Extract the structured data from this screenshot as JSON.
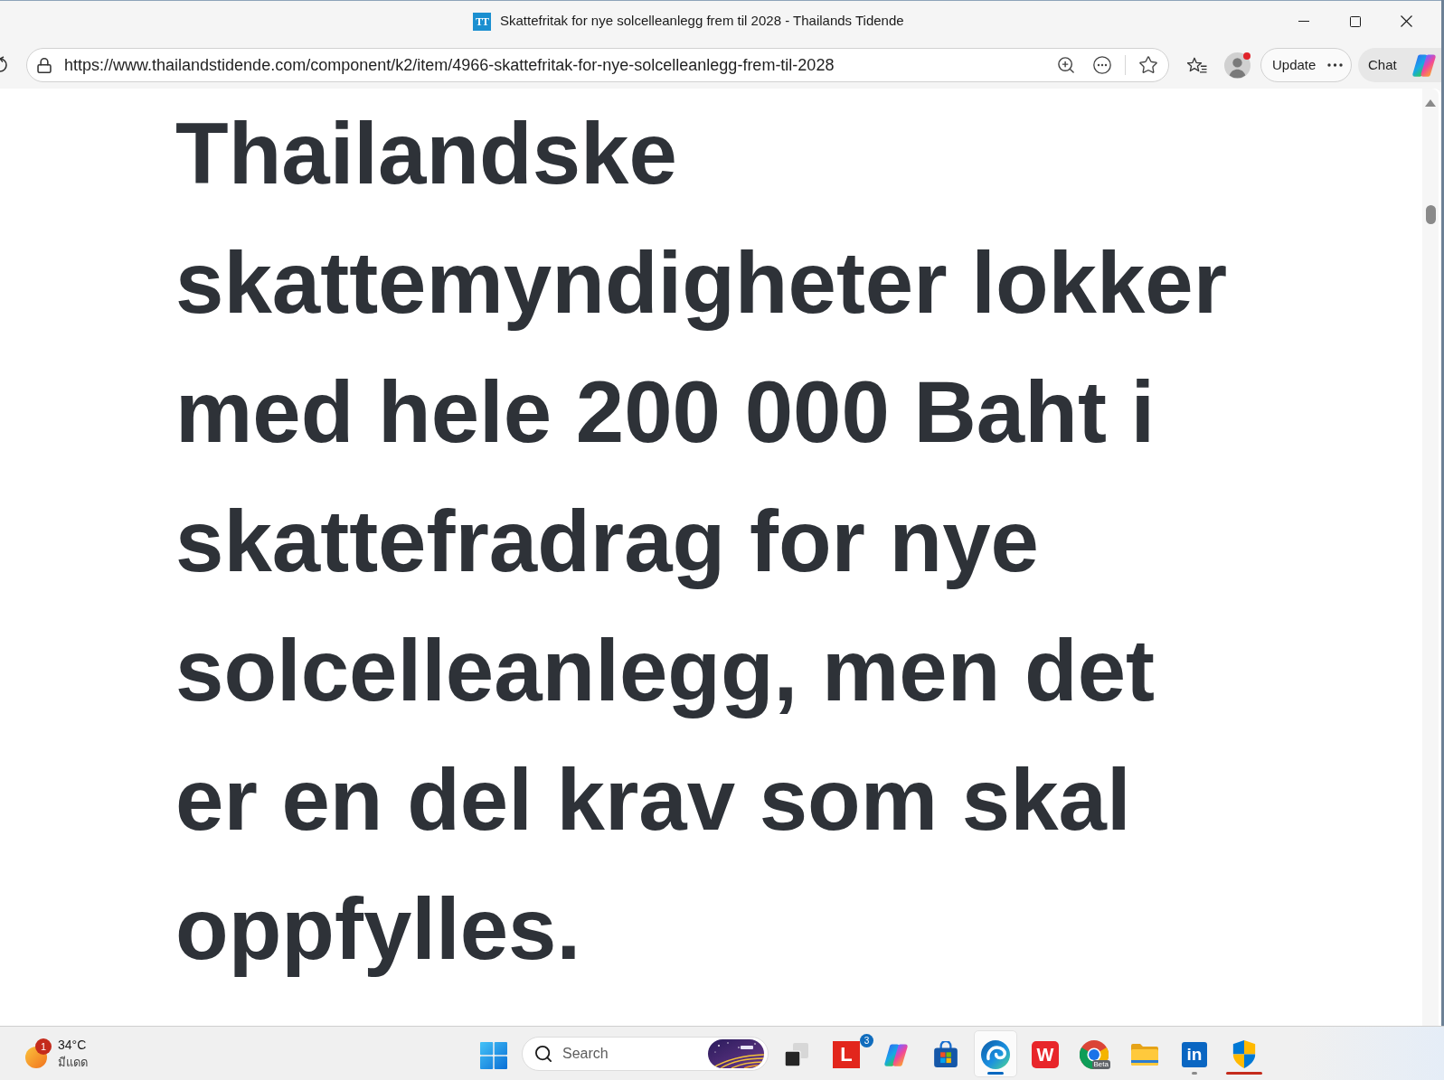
{
  "window": {
    "favicon": "TT",
    "title": "Skattefritak for nye solcelleanlegg frem til 2028 - Thailands Tidende"
  },
  "toolbar": {
    "url": "https://www.thailandstidende.com/component/k2/item/4966-skattefritak-for-nye-solcelleanlegg-frem-til-2028",
    "profile": {
      "notification": true
    },
    "update_button": "Update",
    "chat_button": "Chat"
  },
  "article": {
    "heading": "Thailandske skattemyndigheter lokker med hele 200 000 Baht i skattefradrag for nye solcelleanlegg, men det er en del krav som skal oppfylles."
  },
  "taskbar": {
    "weather": {
      "badge": "1",
      "temperature": "34°C",
      "condition": "มีแดด"
    },
    "search": {
      "placeholder": "Search"
    },
    "apps": [
      {
        "kind": "taskview",
        "selected": false,
        "running": false,
        "alert": false
      },
      {
        "kind": "letter",
        "text": "L",
        "badge": "3",
        "selected": false,
        "running": false,
        "alert": false
      },
      {
        "kind": "ribbon",
        "selected": false,
        "running": false,
        "alert": false
      },
      {
        "kind": "store",
        "selected": false,
        "running": false,
        "alert": false
      },
      {
        "kind": "swirl",
        "selected": true,
        "running": false,
        "alert": false
      },
      {
        "kind": "office",
        "text": "W",
        "selected": false,
        "running": false,
        "alert": false
      },
      {
        "kind": "ring",
        "text": "Beta",
        "selected": false,
        "running": false,
        "alert": false
      },
      {
        "kind": "folder",
        "selected": false,
        "running": false,
        "alert": false
      },
      {
        "kind": "tile",
        "text": "in",
        "selected": false,
        "running": true,
        "alert": false
      },
      {
        "kind": "shield",
        "selected": false,
        "running": false,
        "alert": true
      }
    ]
  }
}
